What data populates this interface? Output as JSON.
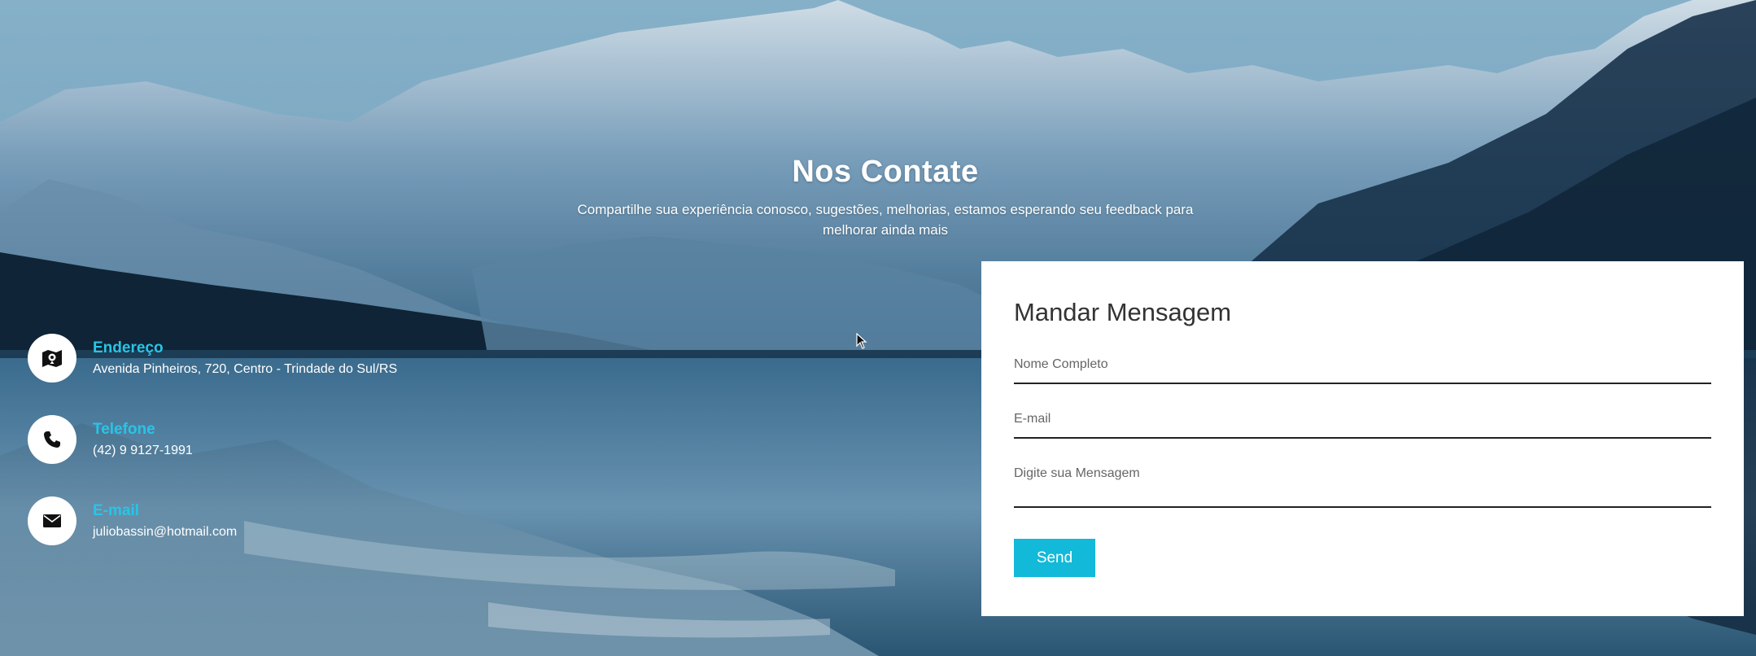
{
  "header": {
    "title": "Nos Contate",
    "subtitle": "Compartilhe sua experiência conosco, sugestões, melhorias, estamos esperando seu feedback para melhorar ainda mais"
  },
  "contact_info": {
    "items": [
      {
        "icon": "map-icon",
        "label": "Endereço",
        "value": "Avenida Pinheiros, 720, Centro - Trindade do Sul/RS"
      },
      {
        "icon": "phone-icon",
        "label": "Telefone",
        "value": "(42) 9 9127-1991"
      },
      {
        "icon": "envelope-icon",
        "label": "E-mail",
        "value": "juliobassin@hotmail.com"
      }
    ]
  },
  "form": {
    "title": "Mandar Mensagem",
    "name_placeholder": "Nome Completo",
    "email_placeholder": "E-mail",
    "message_placeholder": "Digite sua Mensagem",
    "send_label": "Send"
  },
  "colors": {
    "accent": "#12b9d8",
    "label_cyan": "#29c4e6",
    "card_bg": "#ffffff"
  }
}
